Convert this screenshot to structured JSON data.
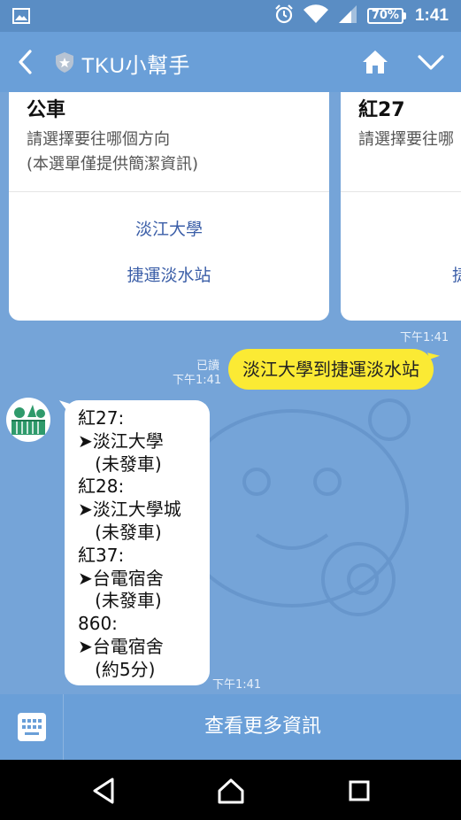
{
  "status_bar": {
    "battery": "70%",
    "time": "1:41"
  },
  "header": {
    "title": "TKU小幫手"
  },
  "cards": [
    {
      "title": "公車",
      "description": "請選擇要往哪個方向\n(本選單僅提供簡潔資訊)",
      "actions": [
        "淡江大學",
        "捷運淡水站"
      ]
    },
    {
      "title": "紅27",
      "description": "請選擇要往哪",
      "actions": [
        "捷"
      ]
    }
  ],
  "timestamps": {
    "card": "下午1:41",
    "outgoing": "下午1:41",
    "incoming": "下午1:41"
  },
  "read_label": "已讀",
  "outgoing_message": "淡江大學到捷運淡水站",
  "incoming_lines": [
    "紅27:",
    "➤淡江大學",
    "   (未發車)",
    "紅28:",
    "➤淡江大學城",
    "   (未發車)",
    "紅37:",
    "➤台電宿舍",
    "   (未發車)",
    "860:",
    "➤台電宿舍",
    "   (約5分)"
  ],
  "bottom_bar": {
    "more_label": "查看更多資訊"
  },
  "icons": {
    "status_left": "image-icon",
    "alarm": "alarm-icon",
    "wifi": "wifi-icon",
    "signal": "signal-icon",
    "back": "back-chevron-icon",
    "shield": "shield-star-icon",
    "home": "home-icon",
    "dropdown": "chevron-down-icon",
    "keyboard": "keyboard-icon"
  },
  "colors": {
    "header": "#6a9fd8",
    "chat_bg": "#75a4d8",
    "outgoing_bubble": "#fbea34",
    "link": "#3c5fa8"
  }
}
